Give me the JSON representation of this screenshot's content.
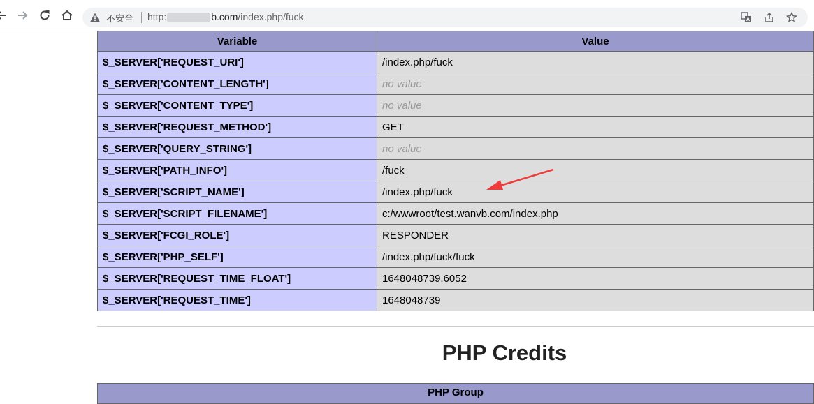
{
  "browser": {
    "security_label": "不安全",
    "url_prefix": "http:",
    "url_host_suffix": "b.com",
    "url_path": "/index.php/fuck"
  },
  "table": {
    "headers": [
      "Variable",
      "Value"
    ],
    "rows": [
      {
        "variable": "$_SERVER['REQUEST_URI']",
        "value": "/index.php/fuck"
      },
      {
        "variable": "$_SERVER['CONTENT_LENGTH']",
        "value": "no value"
      },
      {
        "variable": "$_SERVER['CONTENT_TYPE']",
        "value": "no value"
      },
      {
        "variable": "$_SERVER['REQUEST_METHOD']",
        "value": "GET"
      },
      {
        "variable": "$_SERVER['QUERY_STRING']",
        "value": "no value"
      },
      {
        "variable": "$_SERVER['PATH_INFO']",
        "value": "/fuck"
      },
      {
        "variable": "$_SERVER['SCRIPT_NAME']",
        "value": "/index.php/fuck"
      },
      {
        "variable": "$_SERVER['SCRIPT_FILENAME']",
        "value": "c:/wwwroot/test.wanvb.com/index.php"
      },
      {
        "variable": "$_SERVER['FCGI_ROLE']",
        "value": "RESPONDER"
      },
      {
        "variable": "$_SERVER['PHP_SELF']",
        "value": "/index.php/fuck/fuck"
      },
      {
        "variable": "$_SERVER['REQUEST_TIME_FLOAT']",
        "value": "1648048739.6052"
      },
      {
        "variable": "$_SERVER['REQUEST_TIME']",
        "value": "1648048739"
      }
    ]
  },
  "credits": {
    "title": "PHP Credits",
    "group_header": "PHP Group"
  },
  "colors": {
    "header_bg": "#9999cc",
    "variable_bg": "#ccccff",
    "value_bg": "#dddddd",
    "annotation_arrow": "#ee3b3b"
  }
}
